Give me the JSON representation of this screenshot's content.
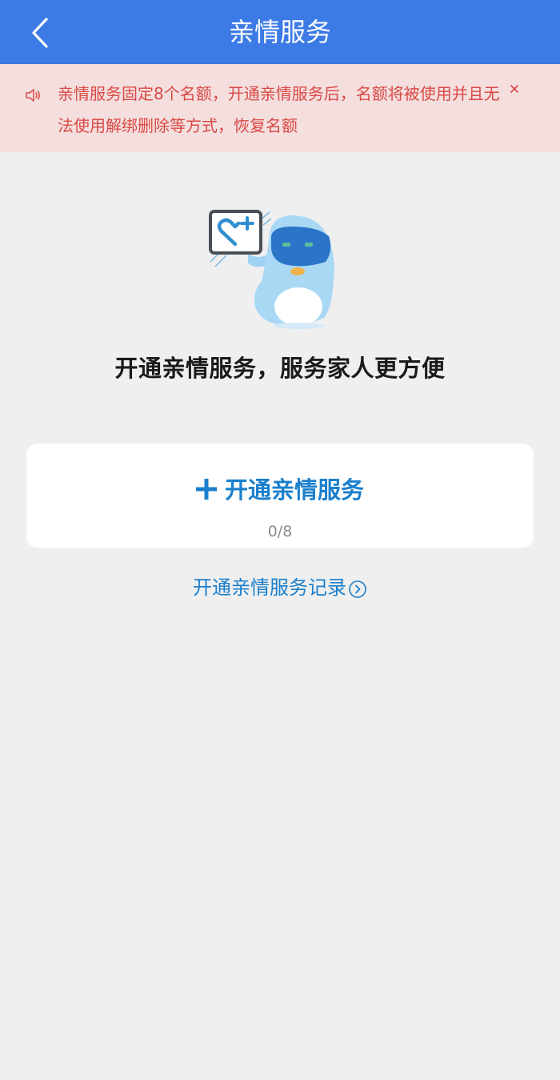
{
  "header": {
    "title": "亲情服务",
    "back_icon": "chevron-left-icon",
    "background_color": "#3c7ae6"
  },
  "notice": {
    "icon": "speaker-icon",
    "text": "亲情服务固定8个名额，开通亲情服务后，名额将被使用并且无法使用解绑删除等方式，恢复名额",
    "close_icon": "close-icon",
    "text_color": "#d94a45",
    "background_color": "#f4dede"
  },
  "hero": {
    "illustration": "penguin-mascot-with-heart-sign",
    "slogan": "开通亲情服务，服务家人更方便"
  },
  "open_card": {
    "icon": "plus-icon",
    "label": "开通亲情服务",
    "quota": "0/8",
    "accent_color": "#1b7fcc"
  },
  "record_link": {
    "label": "开通亲情服务记录",
    "icon": "chevron-right-circle-icon"
  }
}
